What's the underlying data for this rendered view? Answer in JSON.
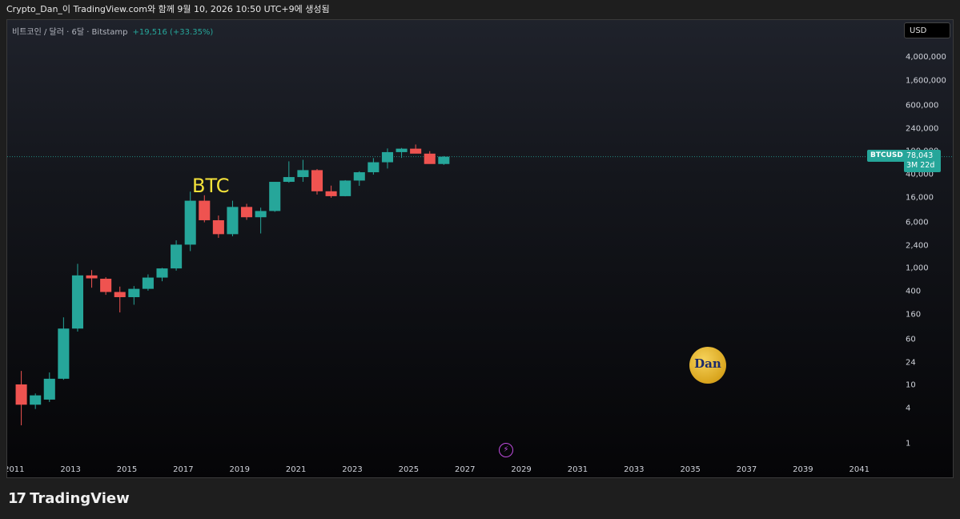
{
  "topbar": {
    "text": "Crypto_Dan_이 TradingView.com와 함께 9월 10, 2026 10:50 UTC+9에 생성됨"
  },
  "legend": {
    "symbol": "비트코인 / 달러 · 6달 · Bitstamp",
    "change": "+19,516 (+33.35%)"
  },
  "currency": "USD",
  "annotation": "BTC",
  "price_badge": {
    "symbol": "BTCUSD",
    "price": "78,043",
    "countdown": "3M 22d"
  },
  "watermark_logo": "Dan",
  "footer": {
    "brand": "TradingView",
    "logo_glyph": "17"
  },
  "colors": {
    "up": "#26a69a",
    "down": "#ef5350",
    "annotation": "#f4e23a",
    "accent": "#26a69a"
  },
  "icons": {
    "flash": "lightning-icon"
  },
  "chart_data": {
    "type": "candlestick",
    "interval": "6M",
    "scale": "log",
    "y_ticks": [
      {
        "label": "4,000,000",
        "value": 4000000
      },
      {
        "label": "1,600,000",
        "value": 1600000
      },
      {
        "label": "600,000",
        "value": 600000
      },
      {
        "label": "240,000",
        "value": 240000
      },
      {
        "label": "100,000",
        "value": 100000
      },
      {
        "label": "40,000",
        "value": 40000
      },
      {
        "label": "16,000",
        "value": 16000
      },
      {
        "label": "6,000",
        "value": 6000
      },
      {
        "label": "2,400",
        "value": 2400
      },
      {
        "label": "1,000",
        "value": 1000
      },
      {
        "label": "400",
        "value": 400
      },
      {
        "label": "160",
        "value": 160
      },
      {
        "label": "60",
        "value": 60
      },
      {
        "label": "24",
        "value": 24
      },
      {
        "label": "10",
        "value": 10
      },
      {
        "label": "4",
        "value": 4
      },
      {
        "label": "1",
        "value": 1
      }
    ],
    "x_ticks": [
      "2011",
      "2013",
      "2015",
      "2017",
      "2019",
      "2021",
      "2023",
      "2025",
      "2027",
      "2029",
      "2031",
      "2033",
      "2035",
      "2037",
      "2039",
      "2041"
    ],
    "x_range": [
      2010.75,
      2042.3
    ],
    "ylim": [
      0.5,
      9000000
    ],
    "last_price": 78043,
    "candles": [
      {
        "t": 2011.0,
        "o": 10,
        "h": 17,
        "l": 2.0,
        "c": 4.5
      },
      {
        "t": 2011.5,
        "o": 4.5,
        "h": 7.0,
        "l": 3.8,
        "c": 6.5
      },
      {
        "t": 2012.0,
        "o": 5.5,
        "h": 16,
        "l": 5.0,
        "c": 12.5
      },
      {
        "t": 2012.5,
        "o": 12.5,
        "h": 140,
        "l": 12,
        "c": 90
      },
      {
        "t": 2013.0,
        "o": 90,
        "h": 1150,
        "l": 80,
        "c": 730
      },
      {
        "t": 2013.5,
        "o": 730,
        "h": 900,
        "l": 450,
        "c": 650
      },
      {
        "t": 2014.0,
        "o": 640,
        "h": 680,
        "l": 340,
        "c": 380
      },
      {
        "t": 2014.5,
        "o": 380,
        "h": 470,
        "l": 170,
        "c": 310
      },
      {
        "t": 2015.0,
        "o": 310,
        "h": 480,
        "l": 230,
        "c": 430
      },
      {
        "t": 2015.5,
        "o": 430,
        "h": 760,
        "l": 400,
        "c": 670
      },
      {
        "t": 2016.0,
        "o": 670,
        "h": 980,
        "l": 580,
        "c": 960
      },
      {
        "t": 2016.5,
        "o": 960,
        "h": 2900,
        "l": 880,
        "c": 2450
      },
      {
        "t": 2017.0,
        "o": 2450,
        "h": 19700,
        "l": 1900,
        "c": 13800
      },
      {
        "t": 2017.5,
        "o": 13800,
        "h": 17100,
        "l": 5900,
        "c": 6400
      },
      {
        "t": 2018.0,
        "o": 6400,
        "h": 7700,
        "l": 3200,
        "c": 3700
      },
      {
        "t": 2018.5,
        "o": 3700,
        "h": 13800,
        "l": 3400,
        "c": 10800
      },
      {
        "t": 2019.0,
        "o": 10800,
        "h": 12200,
        "l": 6500,
        "c": 7200
      },
      {
        "t": 2019.5,
        "o": 7200,
        "h": 10500,
        "l": 3800,
        "c": 9200
      },
      {
        "t": 2020.0,
        "o": 9200,
        "h": 29000,
        "l": 8900,
        "c": 29000
      },
      {
        "t": 2020.5,
        "o": 29000,
        "h": 65000,
        "l": 28000,
        "c": 35000
      },
      {
        "t": 2021.0,
        "o": 35000,
        "h": 69000,
        "l": 29000,
        "c": 46000
      },
      {
        "t": 2021.5,
        "o": 46000,
        "h": 48000,
        "l": 17600,
        "c": 20000
      },
      {
        "t": 2022.0,
        "o": 20000,
        "h": 25000,
        "l": 15500,
        "c": 16500
      },
      {
        "t": 2022.5,
        "o": 16500,
        "h": 31000,
        "l": 16400,
        "c": 30500
      },
      {
        "t": 2023.0,
        "o": 30500,
        "h": 44000,
        "l": 24800,
        "c": 42300
      },
      {
        "t": 2023.5,
        "o": 42300,
        "h": 73800,
        "l": 38500,
        "c": 62700
      },
      {
        "t": 2024.0,
        "o": 62700,
        "h": 108000,
        "l": 49000,
        "c": 93400
      },
      {
        "t": 2024.5,
        "o": 93400,
        "h": 110000,
        "l": 74400,
        "c": 107000
      },
      {
        "t": 2025.0,
        "o": 107000,
        "h": 126000,
        "l": 98000,
        "c": 88000
      },
      {
        "t": 2025.5,
        "o": 88000,
        "h": 97000,
        "l": 60000,
        "c": 58500
      },
      {
        "t": 2026.0,
        "o": 58500,
        "h": 80000,
        "l": 56500,
        "c": 78043
      }
    ]
  }
}
